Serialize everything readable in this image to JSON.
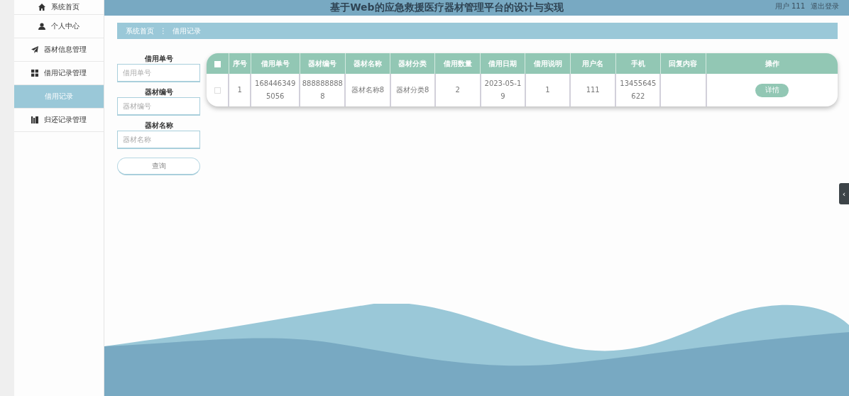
{
  "header": {
    "title": "基于Web的应急救援医疗器材管理平台的设计与实现",
    "user_label": "用户 111",
    "logout": "退出登录"
  },
  "sidebar": {
    "items": [
      {
        "label": "系统首页",
        "selected": false
      },
      {
        "label": "个人中心",
        "selected": false
      },
      {
        "label": "器材信息管理",
        "selected": false
      },
      {
        "label": "借用记录管理",
        "selected": false,
        "children": [
          {
            "label": "借用记录",
            "selected": true
          }
        ]
      },
      {
        "label": "归还记录管理",
        "selected": false
      }
    ]
  },
  "breadcrumb": {
    "items": [
      "系统首页",
      "借用记录"
    ],
    "separator": "⋮"
  },
  "search": {
    "fields": [
      {
        "label": "借用单号",
        "placeholder": "借用单号"
      },
      {
        "label": "器材编号",
        "placeholder": "器材编号"
      },
      {
        "label": "器材名称",
        "placeholder": "器材名称"
      }
    ],
    "button": "查询"
  },
  "table": {
    "select_all_checked": false,
    "columns": [
      "序号",
      "借用单号",
      "器材编号",
      "器材名称",
      "器材分类",
      "借用数量",
      "借用日期",
      "借用说明",
      "用户名",
      "手机",
      "回复内容",
      "操作"
    ],
    "rows": [
      {
        "checked": false,
        "cells": [
          "1",
          "1684463495056",
          "8888888888",
          "器材名称8",
          "器材分类8",
          "2",
          "2023-05-19",
          "1",
          "111",
          "13455645622",
          ""
        ],
        "action": "详情"
      }
    ]
  },
  "side_tab": {
    "glyph": "‹"
  }
}
